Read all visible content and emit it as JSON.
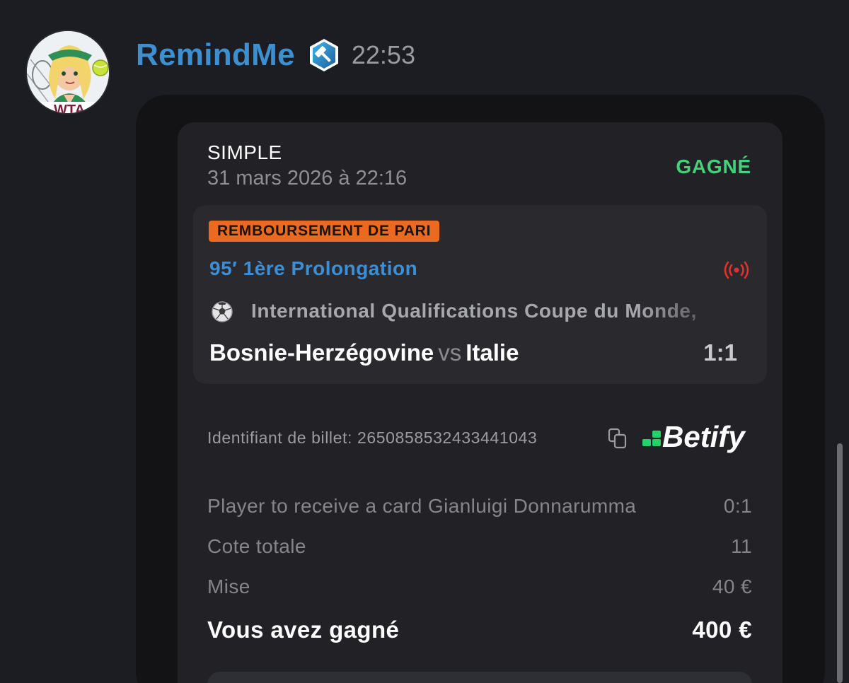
{
  "message": {
    "username": "RemindMe",
    "timestamp": "22:53",
    "avatar_text": "WTA",
    "badge_icon": "moderator-hammer-icon"
  },
  "ticket": {
    "bet_type": "SIMPLE",
    "date": "31 mars 2026 à 22:16",
    "status": "GAGNÉ",
    "refund_tag": "REMBOURSEMENT DE PARI",
    "live_status": "95′ 1ère Prolongation",
    "competition": "International Qualifications Coupe du Monde,",
    "home_team": "Bosnie-Herzégovine",
    "vs": "vs",
    "away_team": "Italie",
    "score": "1:1",
    "ticket_id_label": "Identifiant de billet: 2650858532433441043",
    "brand": "Betify",
    "market_label": "Player to receive a card Gianluigi Donnarumma",
    "market_value": "0:1",
    "odds_label": "Cote totale",
    "odds_value": "11",
    "stake_label": "Mise",
    "stake_value": "40 €",
    "win_label": "Vous avez gagné",
    "win_value": "400 €"
  },
  "colors": {
    "username": "#3d8fd0",
    "status_won": "#45d07a",
    "refund_tag_bg": "#ec6a1f",
    "live_status": "#3c8fd6",
    "live_icon": "#e0302f",
    "brand_green": "#22d36a"
  }
}
